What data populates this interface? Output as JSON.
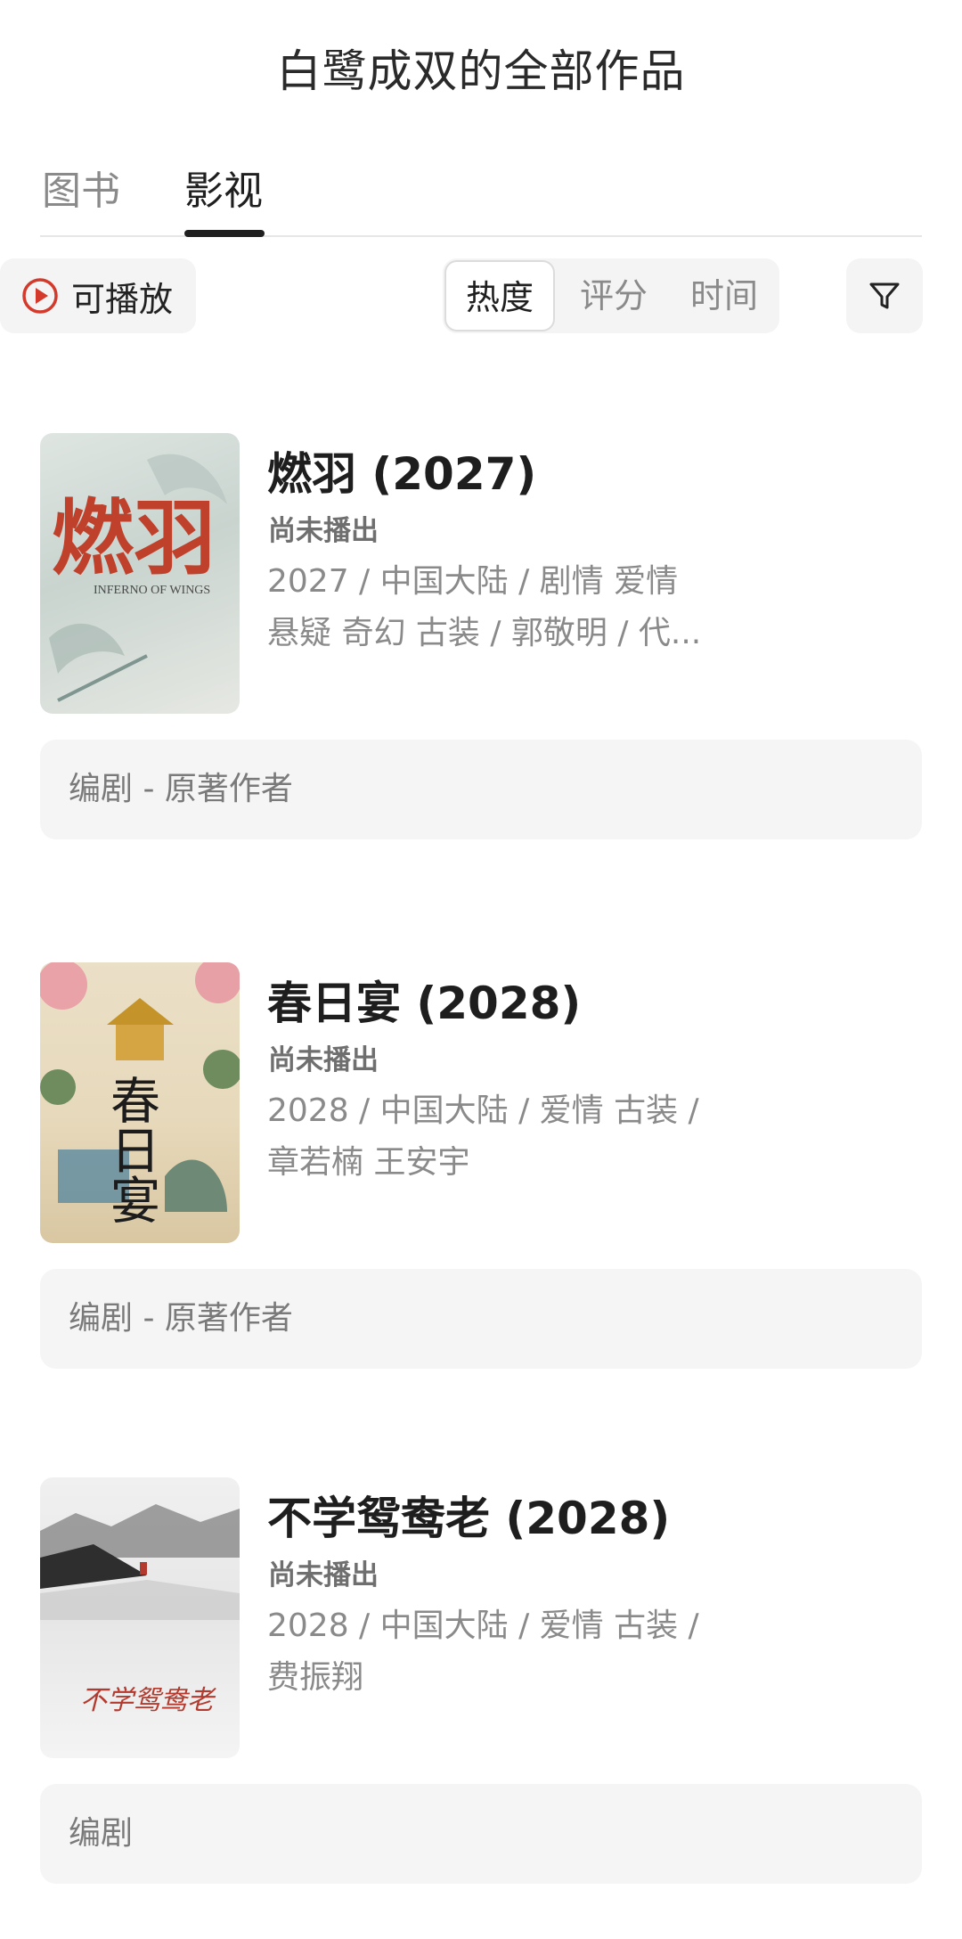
{
  "header": {
    "title": "白鹭成双的全部作品"
  },
  "tabs": [
    {
      "label": "图书",
      "active": false
    },
    {
      "label": "影视",
      "active": true
    }
  ],
  "filters": {
    "playable_label": "可播放",
    "sort_options": [
      "热度",
      "评分",
      "时间"
    ],
    "sort_selected": "热度",
    "filter_icon": "funnel-icon"
  },
  "colors": {
    "accent_red": "#d33a2c",
    "text_primary": "#1e1e1e",
    "text_secondary": "#8a8a8a",
    "chip_bg": "#f4f4f4"
  },
  "works": [
    {
      "title": "燃羽 (2027)",
      "status": "尚未播出",
      "meta_line1": "2027 / 中国大陆 / 剧情 爱情",
      "meta_line2": "悬疑 奇幻 古装 / 郭敬明 / 代...",
      "role": "编剧 - 原著作者",
      "poster_text": "燃羽",
      "poster_subtext": "INFERNO OF WINGS"
    },
    {
      "title": "春日宴 (2028)",
      "status": "尚未播出",
      "meta_line1": "2028 / 中国大陆 / 爱情 古装 /",
      "meta_line2": "章若楠 王安宇",
      "role": "编剧 - 原著作者",
      "poster_text": "春日宴"
    },
    {
      "title": "不学鸳鸯老 (2028)",
      "status": "尚未播出",
      "meta_line1": "2028 / 中国大陆 / 爱情 古装 /",
      "meta_line2": "费振翔",
      "role": "编剧",
      "poster_text": "不学鸳鸯老"
    }
  ]
}
